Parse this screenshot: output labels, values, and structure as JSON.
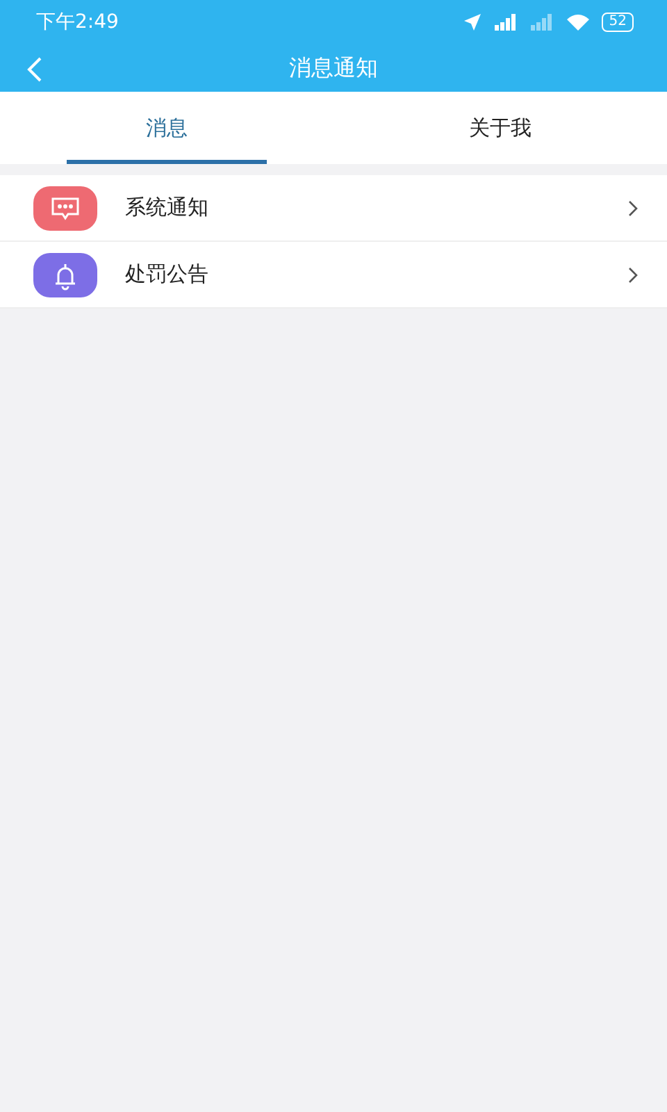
{
  "status_bar": {
    "time": "下午2:49",
    "battery": "52"
  },
  "header": {
    "title": "消息通知"
  },
  "tabs": [
    {
      "label": "消息",
      "selected": true
    },
    {
      "label": "关于我",
      "selected": false
    }
  ],
  "items": [
    {
      "kind": "message",
      "label": "系统通知",
      "color": "#ee6a72"
    },
    {
      "kind": "bell",
      "label": "处罚公告",
      "color": "#7d6ee6"
    }
  ]
}
